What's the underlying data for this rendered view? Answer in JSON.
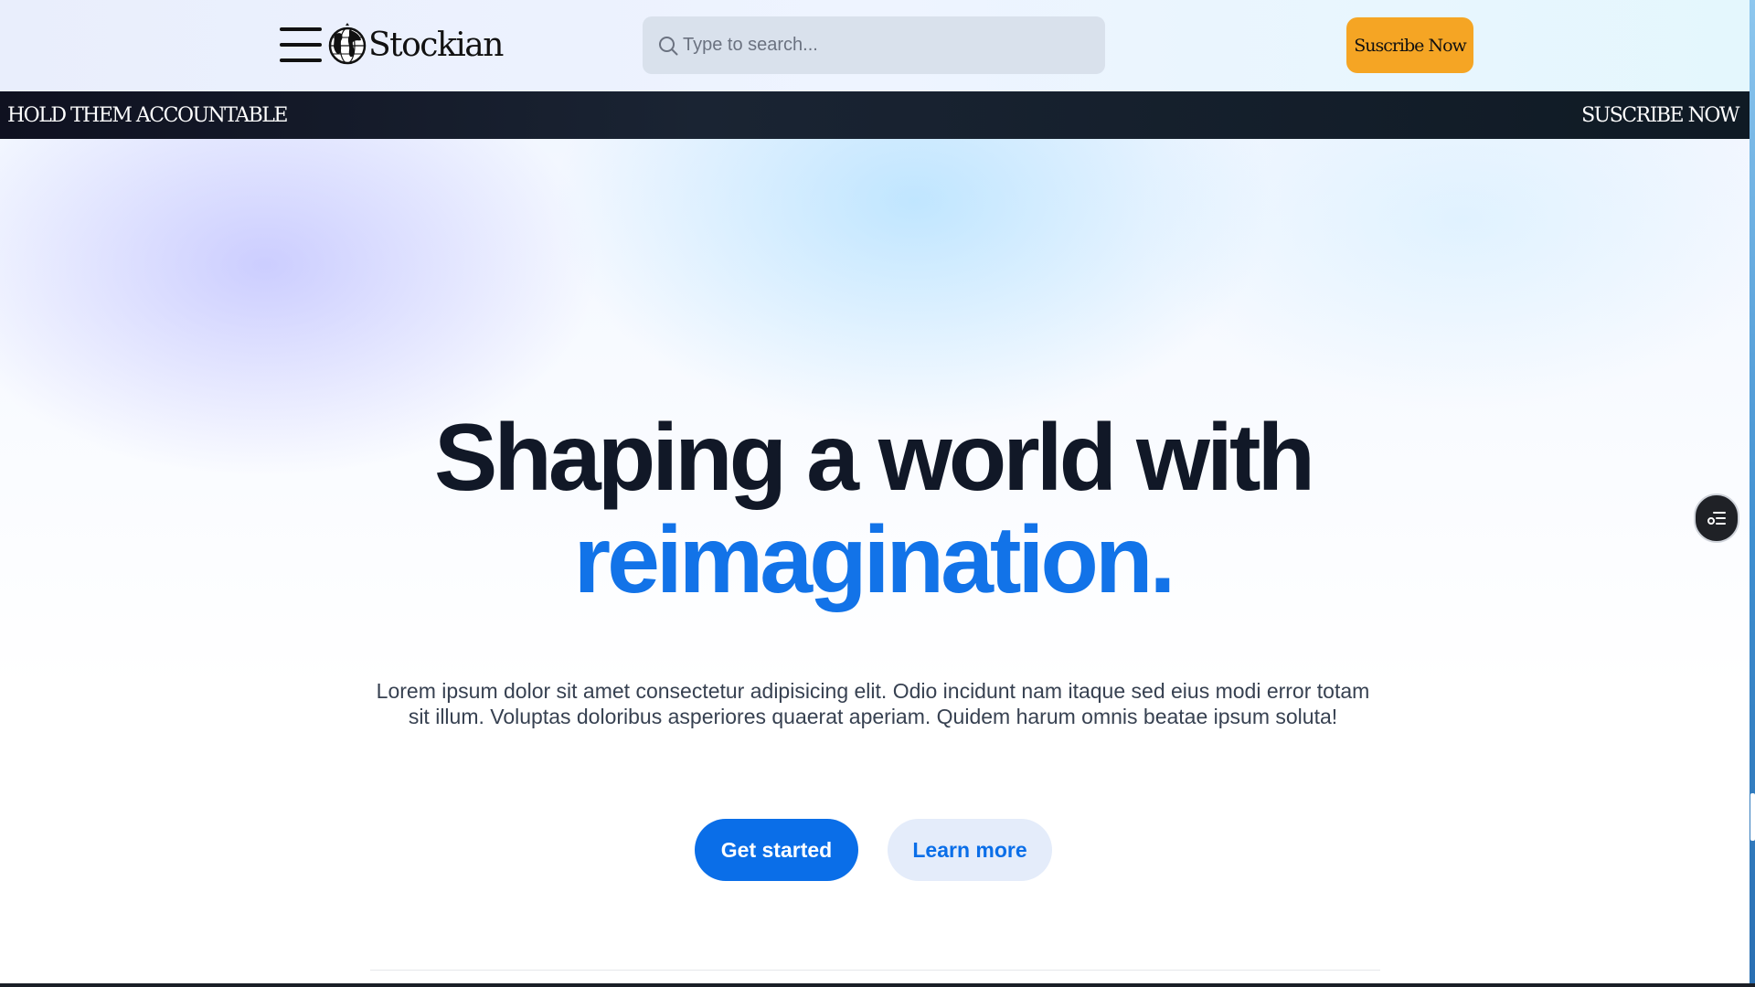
{
  "header": {
    "logo_text": "Stockian",
    "search_placeholder": "Type to search...",
    "subscribe_label": "Suscribe Now"
  },
  "ticker": {
    "left_text": "HOLD THEM ACCOUNTABLE",
    "right_text": "SUSCRIBE NOW"
  },
  "hero": {
    "title_line1": "Shaping a world with",
    "title_line2": "reimagination.",
    "description": "Lorem ipsum dolor sit amet consectetur adipisicing elit. Odio incidunt nam itaque sed eius modi error totam sit illum. Voluptas doloribus asperiores quaerat aperiam. Quidem harum omnis beatae ipsum soluta!",
    "primary_button": "Get started",
    "secondary_button": "Learn more"
  },
  "icons": {
    "menu": "hamburger-menu-icon",
    "logo": "globe-icon",
    "search": "search-icon",
    "floating": "list-settings-icon"
  },
  "colors": {
    "accent": "#1273e8",
    "primary_button": "#0a6ee8",
    "subscribe_button": "#f5a524",
    "ticker_background": "#111a26",
    "heading": "#111827"
  }
}
